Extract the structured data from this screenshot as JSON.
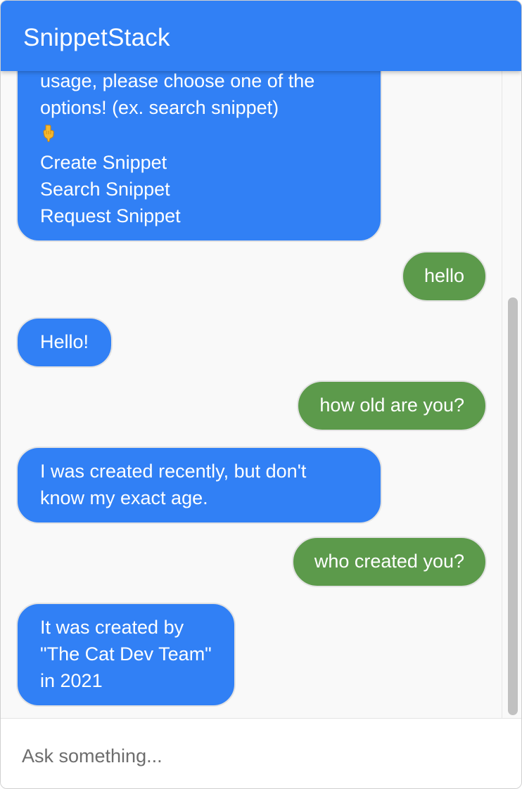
{
  "app": {
    "title": "SnippetStack"
  },
  "messages": [
    {
      "sender": "bot",
      "lines": [
        "usage, please choose one of the",
        "options! (ex. search snippet)",
        "",
        "Create Snippet",
        "Search Snippet",
        "Request Snippet"
      ]
    },
    {
      "sender": "user",
      "lines": [
        "hello"
      ]
    },
    {
      "sender": "bot",
      "lines": [
        "Hello!"
      ]
    },
    {
      "sender": "user",
      "lines": [
        "how old are you?"
      ]
    },
    {
      "sender": "bot",
      "lines": [
        "I was created recently, but don't",
        "know my exact age."
      ]
    },
    {
      "sender": "user",
      "lines": [
        "who created you?"
      ]
    },
    {
      "sender": "bot",
      "lines": [
        "It was created by",
        "\"The Cat Dev Team\"",
        "in 2021"
      ]
    }
  ],
  "input": {
    "value": "",
    "placeholder": "Ask something..."
  },
  "icons": {
    "pointing_down": "backhand-index-pointing-down-icon"
  },
  "colors": {
    "header": "#3180f5",
    "bot_bubble": "#3180f5",
    "user_bubble": "#5c9a4b",
    "chat_background": "#f9f9f9",
    "scrollbar_thumb": "#c1c1c1"
  }
}
